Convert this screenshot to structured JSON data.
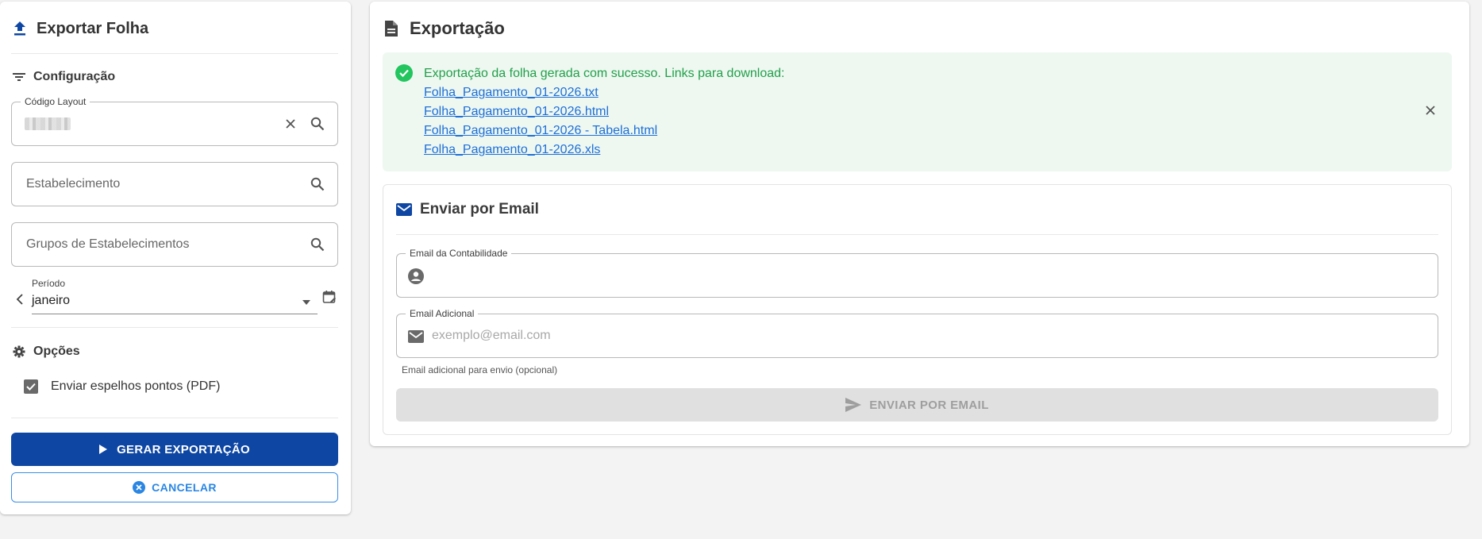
{
  "left_panel": {
    "title": "Exportar Folha",
    "config_title": "Configuração",
    "codigo_layout": {
      "label": "Código Layout",
      "value": ""
    },
    "estabelecimento": {
      "placeholder": "Estabelecimento"
    },
    "grupos": {
      "placeholder": "Grupos de Estabelecimentos"
    },
    "periodo": {
      "label": "Período",
      "value": "janeiro"
    },
    "options_title": "Opções",
    "checkbox_label": "Enviar espelhos pontos (PDF)",
    "checkbox_checked": true,
    "generate_button": "GERAR EXPORTAÇÃO",
    "cancel_button": "CANCELAR"
  },
  "right_panel": {
    "title": "Exportação",
    "alert": {
      "message": "Exportação da folha gerada com sucesso. Links para download:",
      "links": [
        "Folha_Pagamento_01-2026.txt",
        "Folha_Pagamento_01-2026.html",
        "Folha_Pagamento_01-2026 - Tabela.html",
        "Folha_Pagamento_01-2026.xls"
      ]
    },
    "email_section": {
      "title": "Enviar por Email",
      "contabilidade_label": "Email da Contabilidade",
      "contabilidade_value": "",
      "adicional_label": "Email Adicional",
      "adicional_placeholder": "exemplo@email.com",
      "helper_text": "Email adicional para envio (opcional)",
      "send_button": "ENVIAR POR EMAIL"
    }
  },
  "colors": {
    "primary": "#0e46a3",
    "accent": "#2a86e3",
    "success": "#22a04a",
    "success_bg": "#eef8f1",
    "link": "#1e6fd9"
  },
  "icons": {
    "title": "upload-icon",
    "config": "filter-list-icon",
    "options": "gear-icon",
    "export_title": "document-icon",
    "alert": "check-circle-icon",
    "email": "envelope-icon"
  }
}
